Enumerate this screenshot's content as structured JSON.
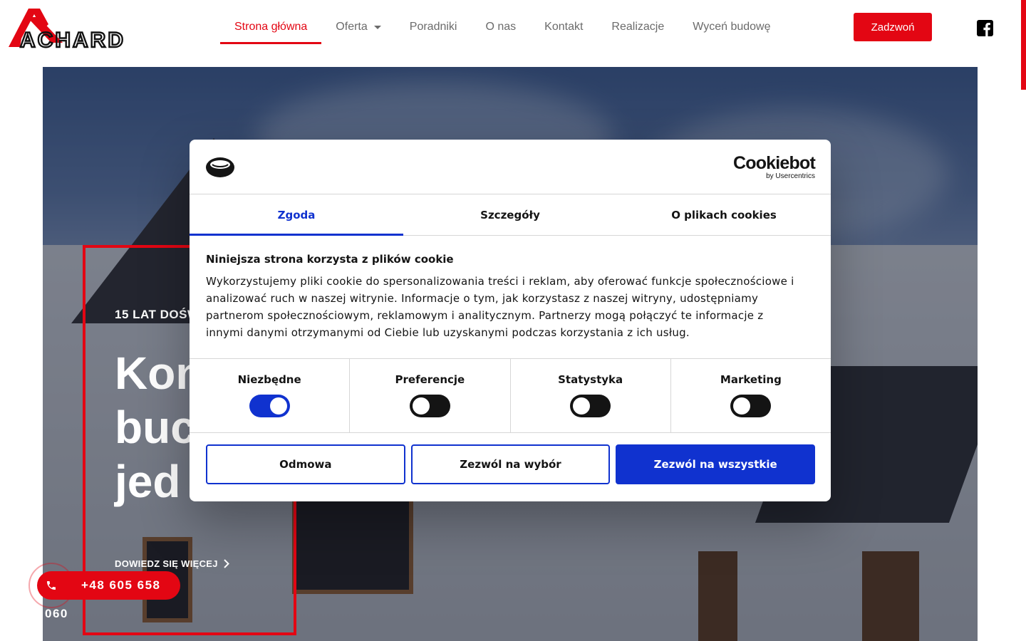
{
  "brand": {
    "logo_text": "ACHARD",
    "accent": "#e30613"
  },
  "nav": {
    "items": [
      {
        "label": "Strona główna",
        "active": true
      },
      {
        "label": "Oferta",
        "has_dropdown": true
      },
      {
        "label": "Poradniki"
      },
      {
        "label": "O nas"
      },
      {
        "label": "Kontakt"
      },
      {
        "label": "Realizacje"
      },
      {
        "label": "Wyceń budowę"
      }
    ],
    "cta_label": "Zadzwoń",
    "social_icon": "facebook-icon"
  },
  "hero": {
    "kicker": "15 LAT DOŚW",
    "title_lines": [
      "Kon",
      "buc",
      "jed"
    ],
    "more_label": "DOWIEDZ SIĘ WIĘCEJ"
  },
  "phone_widget": {
    "number_visible": "+48 605 658",
    "number_tail": "060",
    "icon": "phone-icon"
  },
  "cookie_dialog": {
    "brand_name": "Cookiebot",
    "brand_by": "by Usercentrics",
    "tabs": [
      {
        "label": "Zgoda",
        "active": true
      },
      {
        "label": "Szczegóły"
      },
      {
        "label": "O plikach cookies"
      }
    ],
    "heading": "Niniejsza strona korzysta z plików cookie",
    "text_lines": [
      "Wykorzystujemy pliki cookie do spersonalizowania treści i reklam, aby oferować funkcje społecznościowe i",
      "analizować ruch w naszej witrynie. Informacje o tym, jak korzystasz z naszej witryny, udostępniamy",
      "partnerom społecznościowym, reklamowym i analitycznym. Partnerzy mogą połączyć te informacje z",
      "innymi danymi otrzymanymi od Ciebie lub uzyskanymi podczas korzystania z ich usług."
    ],
    "toggles": [
      {
        "label": "Niezbędne",
        "on": true
      },
      {
        "label": "Preferencje",
        "on": false
      },
      {
        "label": "Statystyka",
        "on": false
      },
      {
        "label": "Marketing",
        "on": false
      }
    ],
    "buttons": {
      "deny": "Odmowa",
      "allow_selection": "Zezwól na wybór",
      "allow_all": "Zezwól na wszystkie"
    },
    "accent": "#1032cf"
  }
}
